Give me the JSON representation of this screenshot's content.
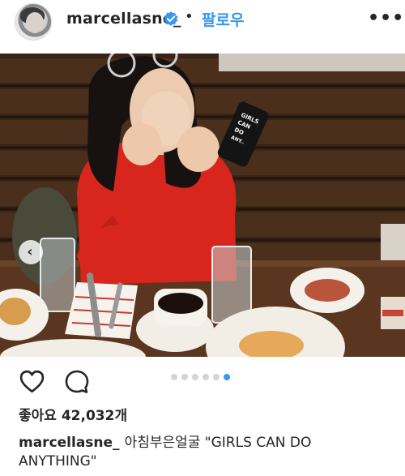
{
  "header": {
    "username": "marcellasne_",
    "separator": "•",
    "follow_label": "팔로우",
    "more_label": "•••"
  },
  "photo": {
    "phone_case_text": "GIRLS CAN DO ANYTHING",
    "current_slide": 6,
    "total_slides": 6
  },
  "actions": {
    "heart_icon": "heart-icon",
    "comment_icon": "comment-icon"
  },
  "likes": {
    "text": "좋아요 42,032개"
  },
  "caption": {
    "username": "marcellasne_",
    "text": "아침부은얼굴 \"GIRLS CAN DO ANYTHING\""
  },
  "colors": {
    "accent": "#3897f0",
    "text": "#262626"
  }
}
